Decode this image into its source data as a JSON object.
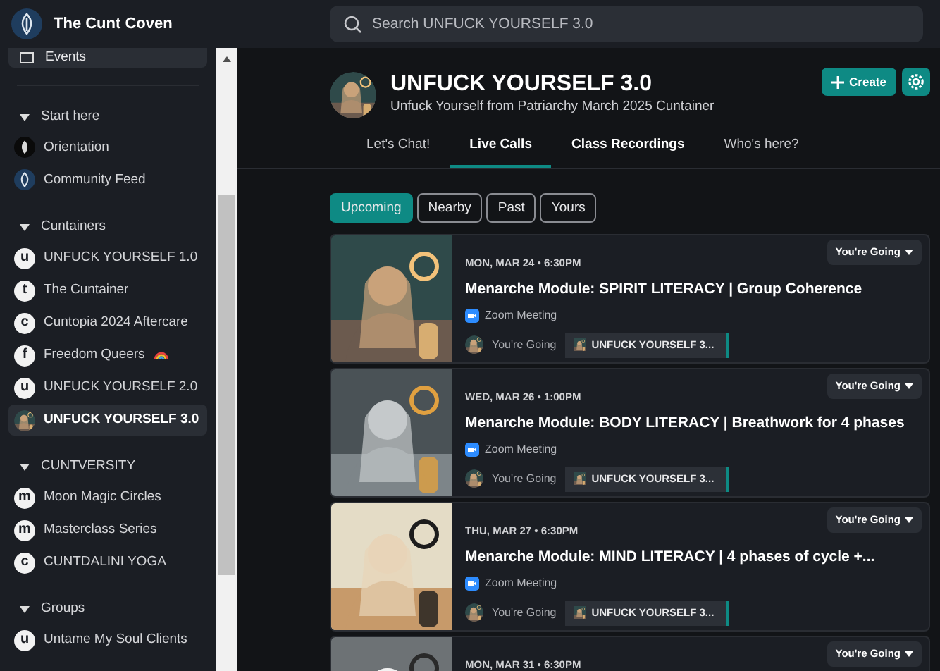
{
  "brand": {
    "name": "The Cunt Coven"
  },
  "search": {
    "placeholder": "Search UNFUCK YOURSELF 3.0"
  },
  "sidebar": {
    "top_item": {
      "label": "Events"
    },
    "sections": [
      {
        "title": "Start here",
        "expanded": true,
        "items": [
          {
            "kind": "dark-logo",
            "label": "Orientation",
            "selected": false
          },
          {
            "kind": "logo",
            "label": "Community Feed",
            "selected": false
          }
        ]
      },
      {
        "title": "Cuntainers",
        "expanded": true,
        "items": [
          {
            "kind": "letter",
            "letter": "u",
            "label": "UNFUCK YOURSELF 1.0",
            "selected": false
          },
          {
            "kind": "letter",
            "letter": "t",
            "label": "The Cuntainer",
            "selected": false
          },
          {
            "kind": "letter",
            "letter": "c",
            "label": "Cuntopia 2024 Aftercare",
            "selected": false
          },
          {
            "kind": "letter",
            "letter": "f",
            "label": "Freedom Queers",
            "rainbow": true,
            "selected": false
          },
          {
            "kind": "letter",
            "letter": "u",
            "label": "UNFUCK YOURSELF 2.0",
            "selected": false
          },
          {
            "kind": "avatar",
            "label": "UNFUCK YOURSELF 3.0",
            "selected": true
          }
        ]
      },
      {
        "title": "CUNTVERSITY",
        "expanded": true,
        "items": [
          {
            "kind": "letter",
            "letter": "m",
            "label": "Moon Magic Circles",
            "selected": false
          },
          {
            "kind": "letter",
            "letter": "m",
            "label": "Masterclass Series",
            "selected": false
          },
          {
            "kind": "letter",
            "letter": "c",
            "label": "CUNTDALINI YOGA",
            "selected": false
          }
        ]
      },
      {
        "title": "Groups",
        "expanded": true,
        "items": [
          {
            "kind": "letter",
            "letter": "u",
            "label": "Untame My Soul Clients",
            "selected": false
          }
        ]
      }
    ]
  },
  "group": {
    "title": "UNFUCK YOURSELF 3.0",
    "subtitle": "Unfuck Yourself from Patriarchy March 2025 Cuntainer",
    "create_label": "Create"
  },
  "tabs": [
    {
      "label": "Let's Chat!",
      "selected": false,
      "hovered": false
    },
    {
      "label": "Live Calls",
      "selected": true,
      "hovered": false
    },
    {
      "label": "Class Recordings",
      "selected": false,
      "hovered": true
    },
    {
      "label": "Who's here?",
      "selected": false,
      "hovered": false
    }
  ],
  "filters": [
    {
      "label": "Upcoming",
      "selected": true
    },
    {
      "label": "Nearby",
      "selected": false
    },
    {
      "label": "Past",
      "selected": false
    },
    {
      "label": "Yours",
      "selected": false
    }
  ],
  "events": [
    {
      "date": "MON, MAR 24 • 6:30PM",
      "title": "Menarche Module: SPIRIT LITERACY | Group Coherence",
      "location": "Zoom Meeting",
      "rsvp": "You're Going",
      "attendance": "You're Going",
      "tag": "UNFUCK YOURSELF 3..."
    },
    {
      "date": "WED, MAR 26 • 1:00PM",
      "title": "Menarche Module: BODY LITERACY | Breathwork for 4 phases",
      "location": "Zoom Meeting",
      "rsvp": "You're Going",
      "attendance": "You're Going",
      "tag": "UNFUCK YOURSELF 3..."
    },
    {
      "date": "THU, MAR 27 • 6:30PM",
      "title": "Menarche Module: MIND LITERACY | 4 phases of cycle +...",
      "location": "Zoom Meeting",
      "rsvp": "You're Going",
      "attendance": "You're Going",
      "tag": "UNFUCK YOURSELF 3..."
    },
    {
      "date": "MON, MAR 31 • 6:30PM",
      "rsvp": "You're Going"
    }
  ]
}
